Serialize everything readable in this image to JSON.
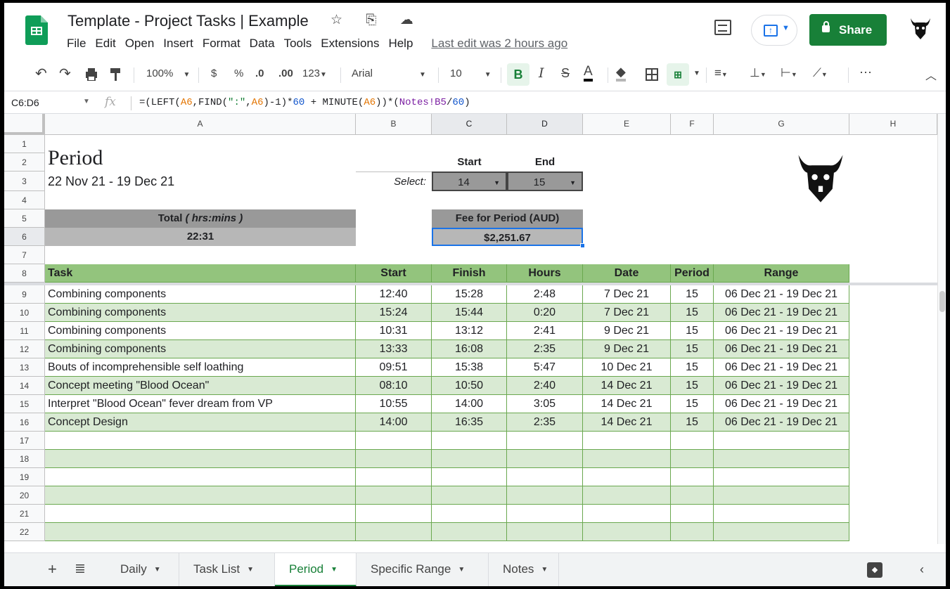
{
  "app": {
    "title": "Template - Project Tasks | Example",
    "title_icons": "☆ ⎘ ☁",
    "last_edit": "Last edit was 2 hours ago",
    "share_label": "Share",
    "menu": [
      "File",
      "Edit",
      "Open",
      "Insert",
      "Format",
      "Data",
      "Tools",
      "Extensions",
      "Help"
    ]
  },
  "toolbar": {
    "zoom": "100%",
    "currency": "$",
    "percent": "%",
    "dec_less": ".0",
    "dec_more": ".00",
    "format_123": "123",
    "font": "Arial",
    "font_size": "10",
    "bold": "B",
    "italic": "I",
    "strike": "S",
    "text_color": "A",
    "more": "⋯"
  },
  "formula_bar": {
    "name_box": "C6:D6",
    "fx": "fx",
    "formula_parts": [
      "=(LEFT(",
      "A6",
      ",FIND(",
      "\":\"",
      ",",
      "A6",
      ")-1)*",
      "60",
      " + MINUTE(",
      "A6",
      "))*(",
      "Notes!B5",
      "/",
      "60",
      ")"
    ]
  },
  "columns": [
    {
      "id": "A",
      "label": "A",
      "width": 442
    },
    {
      "id": "B",
      "label": "B",
      "width": 108
    },
    {
      "id": "C",
      "label": "C",
      "width": 107
    },
    {
      "id": "D",
      "label": "D",
      "width": 108
    },
    {
      "id": "E",
      "label": "E",
      "width": 125
    },
    {
      "id": "F",
      "label": "F",
      "width": 61
    },
    {
      "id": "G",
      "label": "G",
      "width": 193
    },
    {
      "id": "H",
      "label": "H",
      "width": 125
    }
  ],
  "rows": [
    1,
    2,
    3,
    4,
    5,
    6,
    7,
    8,
    9,
    10,
    11,
    12,
    13,
    14,
    15,
    16,
    17,
    18,
    19,
    20,
    21,
    22
  ],
  "sheet": {
    "period_title": "Period",
    "period_range": "22 Nov 21 - 19 Dec 21",
    "select_label": "Select:",
    "start_label": "Start",
    "end_label": "End",
    "start_value": "14",
    "end_value": "15",
    "total_label": "Total",
    "total_unit": "( hrs:mins )",
    "total_value": "22:31",
    "fee_label": "Fee for Period (AUD)",
    "fee_value": "$2,251.67"
  },
  "table": {
    "headers": [
      "Task",
      "Start",
      "Finish",
      "Hours",
      "Date",
      "Period",
      "Range"
    ],
    "rows": [
      [
        "Combining components",
        "12:40",
        "15:28",
        "2:48",
        "7 Dec 21",
        "15",
        "06 Dec 21 - 19 Dec 21"
      ],
      [
        "Combining components",
        "15:24",
        "15:44",
        "0:20",
        "7 Dec 21",
        "15",
        "06 Dec 21 - 19 Dec 21"
      ],
      [
        "Combining components",
        "10:31",
        "13:12",
        "2:41",
        "9 Dec 21",
        "15",
        "06 Dec 21 - 19 Dec 21"
      ],
      [
        "Combining components",
        "13:33",
        "16:08",
        "2:35",
        "9 Dec 21",
        "15",
        "06 Dec 21 - 19 Dec 21"
      ],
      [
        "Bouts of incomprehensible self loathing",
        "09:51",
        "15:38",
        "5:47",
        "10 Dec 21",
        "15",
        "06 Dec 21 - 19 Dec 21"
      ],
      [
        "Concept meeting \"Blood Ocean\"",
        "08:10",
        "10:50",
        "2:40",
        "14 Dec 21",
        "15",
        "06 Dec 21 - 19 Dec 21"
      ],
      [
        "Interpret \"Blood Ocean\" fever dream from VP",
        "10:55",
        "14:00",
        "3:05",
        "14 Dec 21",
        "15",
        "06 Dec 21 - 19 Dec 21"
      ],
      [
        "Concept Design",
        "14:00",
        "16:35",
        "2:35",
        "14 Dec 21",
        "15",
        "06 Dec 21 - 19 Dec 21"
      ]
    ],
    "empty_rows": 6
  },
  "tabs": [
    {
      "label": "Daily",
      "active": false
    },
    {
      "label": "Task List",
      "active": false
    },
    {
      "label": "Period",
      "active": true
    },
    {
      "label": "Specific Range",
      "active": false
    },
    {
      "label": "Notes",
      "active": false
    }
  ],
  "colors": {
    "brand_green": "#188038",
    "header_green": "#93c47d",
    "band_green": "#d9ead3",
    "grey_dark": "#999999",
    "grey_light": "#b7b7b7",
    "select_blue": "#1a73e8"
  }
}
